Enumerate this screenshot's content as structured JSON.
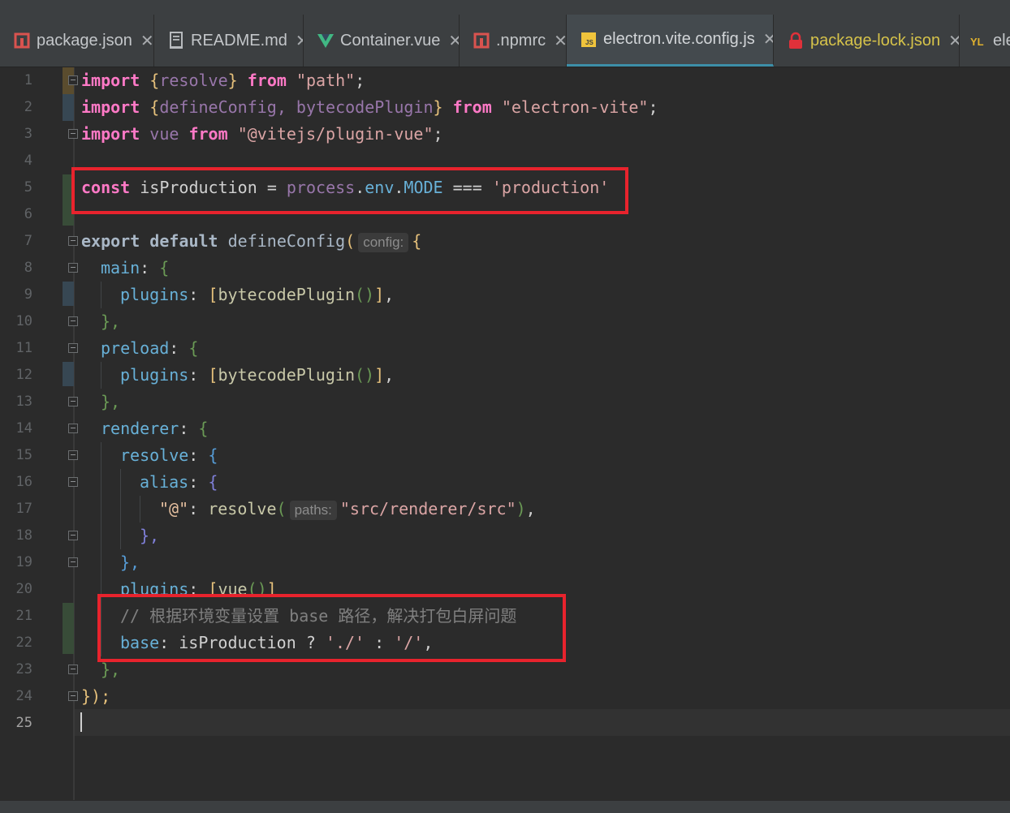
{
  "tabs": [
    {
      "label": "package.json",
      "icon": "npm-icon"
    },
    {
      "label": "README.md",
      "icon": "markdown-icon"
    },
    {
      "label": "Container.vue",
      "icon": "vue-icon"
    },
    {
      "label": ".npmrc",
      "icon": "npm-icon"
    },
    {
      "label": "electron.vite.config.js",
      "icon": "js-icon",
      "active": true
    },
    {
      "label": "package-lock.json",
      "icon": "lock-icon"
    },
    {
      "label": "ele",
      "icon": "yaml-icon"
    }
  ],
  "editor": {
    "line_numbers": [
      "1",
      "2",
      "3",
      "4",
      "5",
      "6",
      "7",
      "8",
      "9",
      "10",
      "11",
      "12",
      "13",
      "14",
      "15",
      "16",
      "17",
      "18",
      "19",
      "20",
      "21",
      "22",
      "23",
      "24",
      "25"
    ],
    "current_line": 25,
    "hints": {
      "config": "config:",
      "paths": "paths:"
    },
    "tokens": {
      "l1": {
        "kw": "import",
        "b1": "{",
        "id": "resolve",
        "b2": "}",
        "from": "from",
        "str": "\"path\"",
        "end": ";"
      },
      "l2": {
        "kw": "import",
        "b1": "{",
        "id": "defineConfig, bytecodePlugin",
        "b2": "}",
        "from": "from",
        "str": "\"electron-vite\"",
        "end": ";"
      },
      "l3": {
        "kw": "import",
        "id": "vue",
        "from": "from",
        "str": "\"@vitejs/plugin-vue\"",
        "end": ";"
      },
      "l5": {
        "kw": "const",
        "id": "isProduction",
        "op": "=",
        "obj": "process",
        "dot1": ".",
        "p1": "env",
        "dot2": ".",
        "p2": "MODE",
        "eq": "===",
        "str": "'production'"
      },
      "l7": {
        "kw1": "export",
        "kw2": "default",
        "fn": "defineConfig",
        "paren": "(",
        "brace": "{"
      },
      "l8": {
        "key": "main",
        "colon": ":",
        "brace": "{"
      },
      "l9": {
        "key": "plugins",
        "colon": ":",
        "arr": "[",
        "fn": "bytecodePlugin",
        "call": "()",
        "arr2": "]",
        "end": ","
      },
      "l10": {
        "close": "},"
      },
      "l11": {
        "key": "preload",
        "colon": ":",
        "brace": "{"
      },
      "l12": {
        "key": "plugins",
        "colon": ":",
        "arr": "[",
        "fn": "bytecodePlugin",
        "call": "()",
        "arr2": "]",
        "end": ","
      },
      "l13": {
        "close": "},"
      },
      "l14": {
        "key": "renderer",
        "colon": ":",
        "brace": "{"
      },
      "l15": {
        "key": "resolve",
        "colon": ":",
        "brace": "{"
      },
      "l16": {
        "key": "alias",
        "colon": ":",
        "brace": "{"
      },
      "l17": {
        "key": "\"@\"",
        "colon": ":",
        "fn": "resolve",
        "paren": "(",
        "str": "\"src/renderer/src\"",
        "paren2": ")",
        "end": ","
      },
      "l18": {
        "close": "},"
      },
      "l19": {
        "close": "},"
      },
      "l20": {
        "key": "plugins",
        "colon": ":",
        "arr": "[",
        "fn": "vue",
        "call": "()",
        "arr2": "]"
      },
      "l21": {
        "comment": "// 根据环境变量设置 base 路径，解决打包白屏问题"
      },
      "l22": {
        "key": "base",
        "colon": ":",
        "id": "isProduction",
        "q": "?",
        "s1": "'./'",
        "c": ":",
        "s2": "'/'",
        "end": ","
      },
      "l23": {
        "close": "},"
      },
      "l24": {
        "close": "});"
      }
    }
  }
}
